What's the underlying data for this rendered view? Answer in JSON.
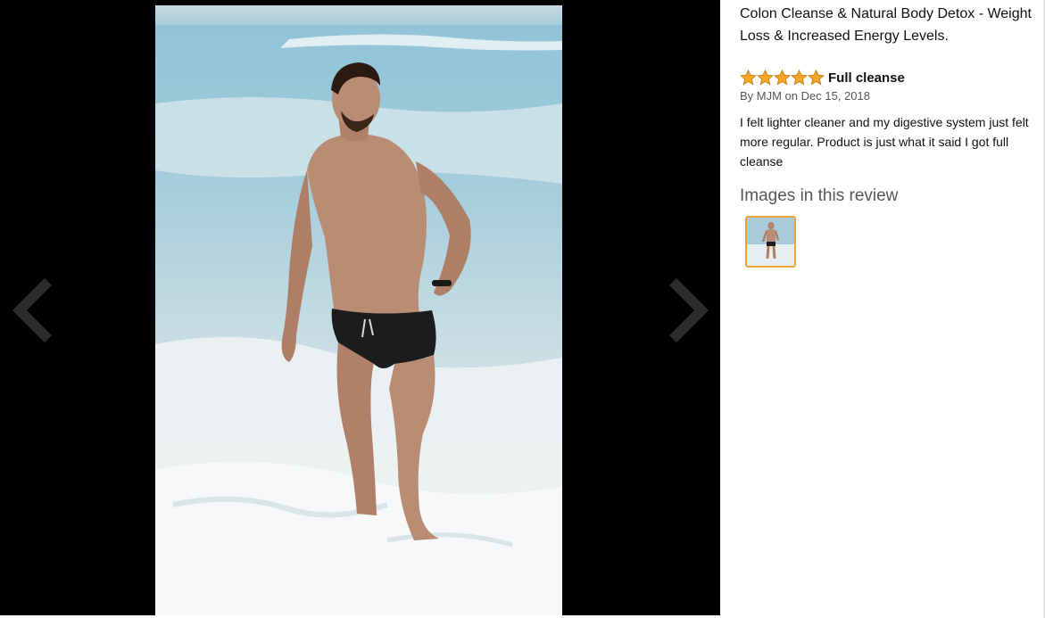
{
  "viewer": {
    "background": "#000000",
    "prev_icon": "chevron-left-icon",
    "next_icon": "chevron-right-icon"
  },
  "product": {
    "title": "Colon Cleanse & Natural Body Detox - Weight Loss & Increased Energy Levels."
  },
  "review": {
    "rating": 5,
    "rating_max": 5,
    "star_color": "#f5a623",
    "title": "Full cleanse",
    "byline": "By MJM on Dec 15, 2018",
    "body": "I felt lighter cleaner and my digestive system just felt more regular. Product is just what it said I got full cleanse"
  },
  "images_section": {
    "heading": "Images in this review",
    "thumbnail_count": 1,
    "selected_border_color": "#e8a53a"
  }
}
